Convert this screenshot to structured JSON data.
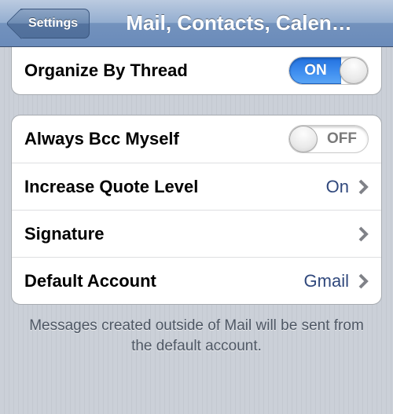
{
  "nav": {
    "back_label": "Settings",
    "title": "Mail, Contacts, Calen…"
  },
  "switch": {
    "on": "ON",
    "off": "OFF"
  },
  "group1": {
    "organize_by_thread": {
      "label": "Organize By Thread",
      "state": "on"
    }
  },
  "group2": {
    "always_bcc": {
      "label": "Always Bcc Myself",
      "state": "off"
    },
    "increase_quote": {
      "label": "Increase Quote Level",
      "value": "On"
    },
    "signature": {
      "label": "Signature",
      "value": ""
    },
    "default_account": {
      "label": "Default Account",
      "value": "Gmail"
    }
  },
  "footer": "Messages created outside of Mail will be sent from the default account."
}
